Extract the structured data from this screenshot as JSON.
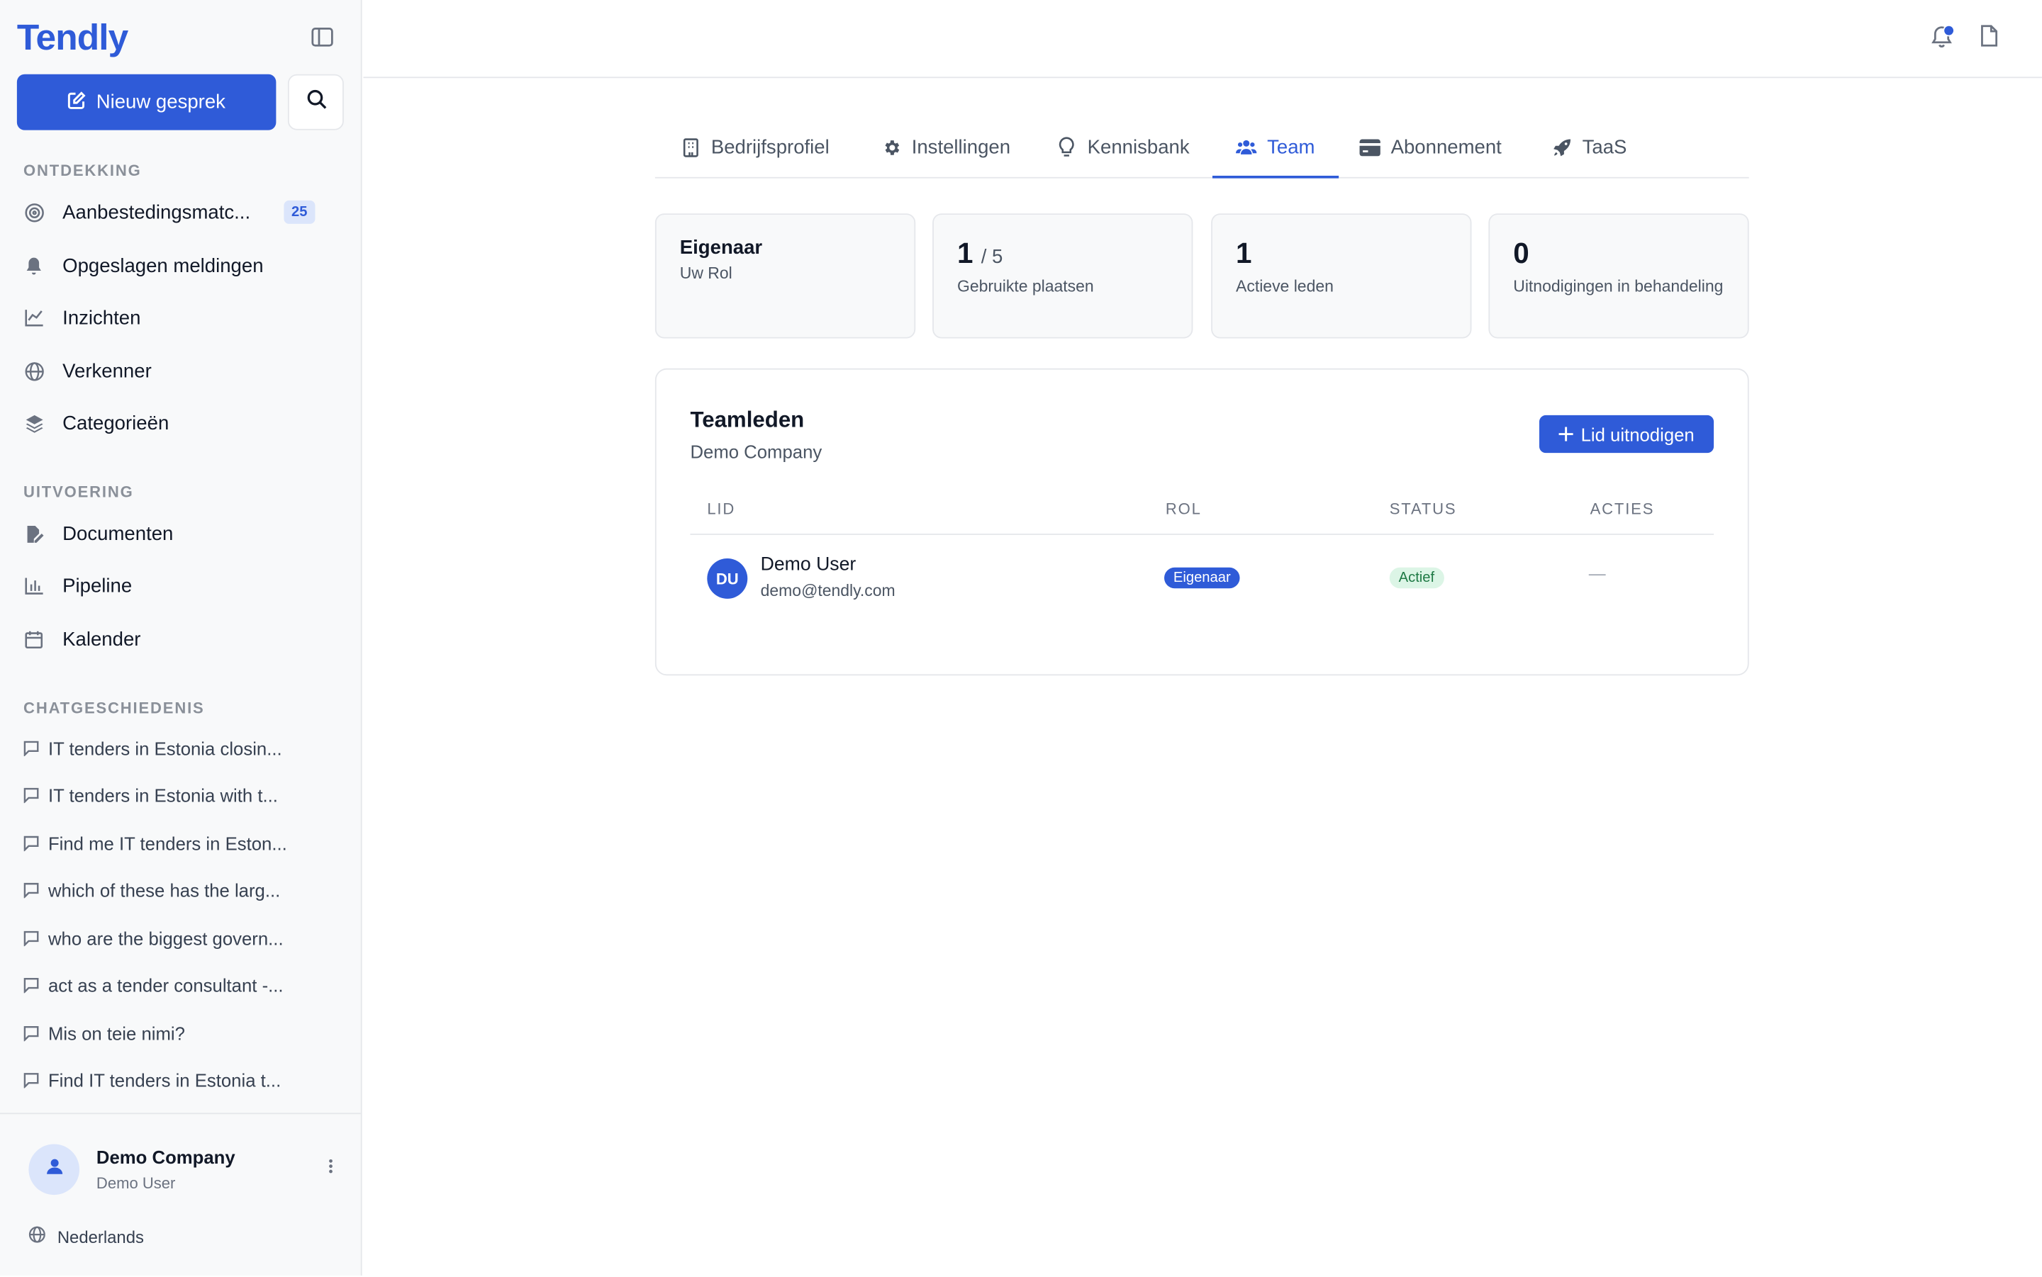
{
  "app": {
    "logo": "Tendly"
  },
  "sidebar": {
    "new_chat_label": "Nieuw gesprek",
    "discovery_title": "ONTDEKKING",
    "discovery_items": [
      {
        "label": "Aanbestedingsmatc...",
        "icon": "target-icon",
        "badge": "25"
      },
      {
        "label": "Opgeslagen meldingen",
        "icon": "bell-icon"
      },
      {
        "label": "Inzichten",
        "icon": "line-chart-icon"
      },
      {
        "label": "Verkenner",
        "icon": "globe-icon"
      },
      {
        "label": "Categorieën",
        "icon": "layers-icon"
      }
    ],
    "execution_title": "UITVOERING",
    "execution_items": [
      {
        "label": "Documenten",
        "icon": "file-edit-icon"
      },
      {
        "label": "Pipeline",
        "icon": "bar-chart-icon"
      },
      {
        "label": "Kalender",
        "icon": "calendar-icon"
      }
    ],
    "history_title": "CHATGESCHIEDENIS",
    "history_items": [
      "IT tenders in Estonia closin...",
      "IT tenders in Estonia with t...",
      "Find me IT tenders in Eston...",
      "which of these has the larg...",
      "who are the biggest govern...",
      "act as a tender consultant -...",
      "Mis on teie nimi?",
      "Find IT tenders in Estonia t..."
    ],
    "footer": {
      "company": "Demo Company",
      "user": "Demo User",
      "language": "Nederlands"
    }
  },
  "tabs": [
    {
      "label": "Bedrijfsprofiel",
      "icon": "building-icon",
      "active": false
    },
    {
      "label": "Instellingen",
      "icon": "gear-icon",
      "active": false
    },
    {
      "label": "Kennisbank",
      "icon": "lightbulb-icon",
      "active": false
    },
    {
      "label": "Team",
      "icon": "users-icon",
      "active": true
    },
    {
      "label": "Abonnement",
      "icon": "credit-card-icon",
      "active": false
    },
    {
      "label": "TaaS",
      "icon": "rocket-icon",
      "active": false
    }
  ],
  "stats": {
    "role": {
      "value": "Eigenaar",
      "label": "Uw Rol"
    },
    "seats": {
      "used": "1",
      "total": "/ 5",
      "label": "Gebruikte plaatsen"
    },
    "active": {
      "value": "1",
      "label": "Actieve leden"
    },
    "invites": {
      "value": "0",
      "label": "Uitnodigingen in behandeling"
    }
  },
  "team": {
    "title": "Teamleden",
    "subtitle": "Demo Company",
    "invite_label": "Lid uitnodigen",
    "columns": [
      "LID",
      "ROL",
      "STATUS",
      "ACTIES"
    ],
    "members": [
      {
        "initials": "DU",
        "name": "Demo User",
        "email": "demo@tendly.com",
        "role": "Eigenaar",
        "status": "Actief",
        "actions": "—"
      }
    ]
  },
  "colors": {
    "accent": "#2f5bd8",
    "status_active_bg": "#dcf5e6",
    "status_active_text": "#1f7a45"
  }
}
